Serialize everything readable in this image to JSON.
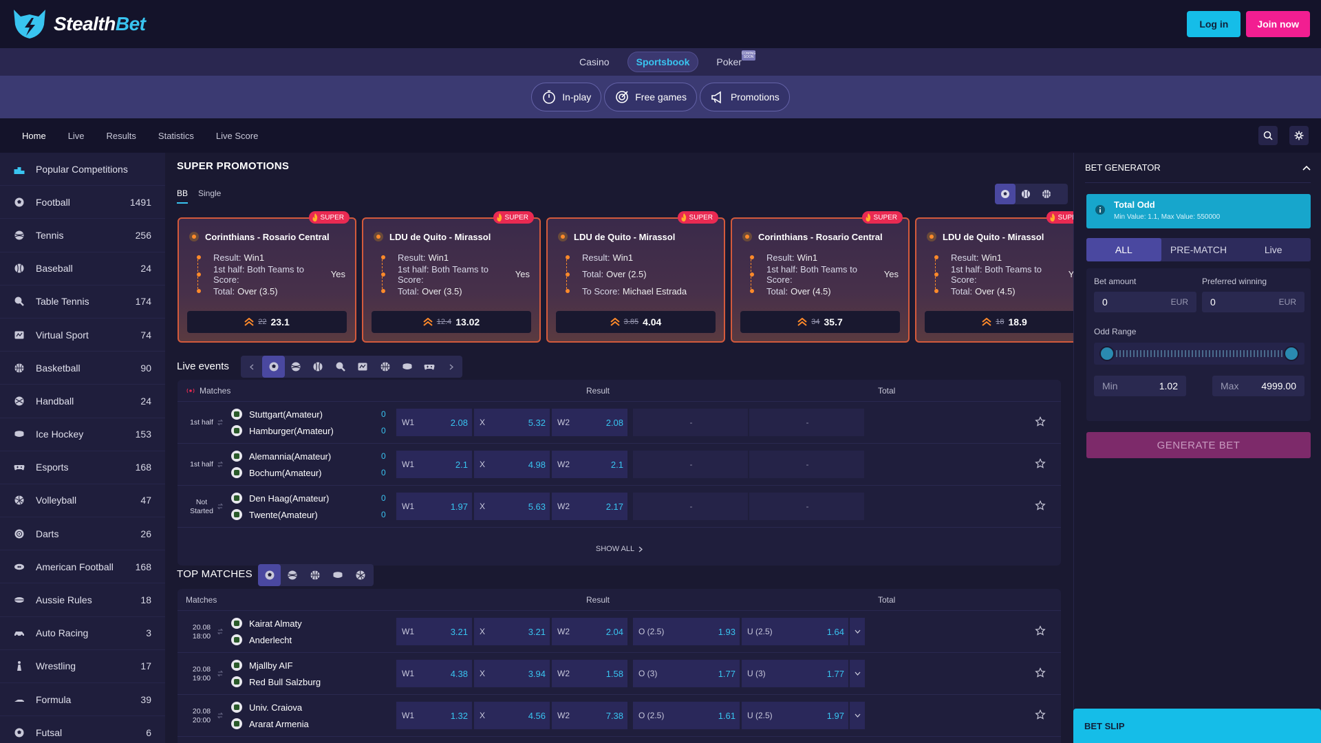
{
  "brand": {
    "name_main": "Stealth",
    "name_accent": "Bet"
  },
  "auth": {
    "login": "Log in",
    "join": "Join now"
  },
  "products": [
    {
      "label": "Casino",
      "active": false
    },
    {
      "label": "Sportsbook",
      "active": true
    },
    {
      "label": "Poker",
      "active": false,
      "badge": "COMING SOON"
    }
  ],
  "subnav": [
    {
      "label": "In-play",
      "icon": "stopwatch-icon"
    },
    {
      "label": "Free games",
      "icon": "target-icon"
    },
    {
      "label": "Promotions",
      "icon": "megaphone-icon"
    }
  ],
  "mainnav": [
    "Home",
    "Live",
    "Results",
    "Statistics",
    "Live Score"
  ],
  "sidebar": [
    {
      "label": "Popular Competitions",
      "count": "",
      "icon": "podium-icon"
    },
    {
      "label": "Football",
      "count": "1491",
      "icon": "football-icon"
    },
    {
      "label": "Tennis",
      "count": "256",
      "icon": "tennis-icon"
    },
    {
      "label": "Baseball",
      "count": "24",
      "icon": "baseball-icon"
    },
    {
      "label": "Table Tennis",
      "count": "174",
      "icon": "table-tennis-icon"
    },
    {
      "label": "Virtual Sport",
      "count": "74",
      "icon": "virtual-sport-icon"
    },
    {
      "label": "Basketball",
      "count": "90",
      "icon": "basketball-icon"
    },
    {
      "label": "Handball",
      "count": "24",
      "icon": "handball-icon"
    },
    {
      "label": "Ice Hockey",
      "count": "153",
      "icon": "ice-hockey-icon"
    },
    {
      "label": "Esports",
      "count": "168",
      "icon": "gamepad-icon"
    },
    {
      "label": "Volleyball",
      "count": "47",
      "icon": "volleyball-icon"
    },
    {
      "label": "Darts",
      "count": "26",
      "icon": "darts-icon"
    },
    {
      "label": "American Football",
      "count": "168",
      "icon": "american-football-icon"
    },
    {
      "label": "Aussie Rules",
      "count": "18",
      "icon": "aussie-rules-icon"
    },
    {
      "label": "Auto Racing",
      "count": "3",
      "icon": "car-icon"
    },
    {
      "label": "Wrestling",
      "count": "17",
      "icon": "wrestling-icon"
    },
    {
      "label": "Formula",
      "count": "39",
      "icon": "formula-icon"
    },
    {
      "label": "Futsal",
      "count": "6",
      "icon": "futsal-icon"
    }
  ],
  "super": {
    "title": "SUPER PROMOTIONS",
    "tabs": [
      "BB",
      "Single"
    ],
    "badge": "SUPER",
    "cards": [
      {
        "match": "Corinthians - Rosario Central",
        "items": [
          [
            "Result:",
            "Win1"
          ],
          [
            "1st half: Both Teams to Score:",
            "Yes"
          ],
          [
            "Total:",
            "Over (3.5)"
          ]
        ],
        "old": "22",
        "odd": "23.1"
      },
      {
        "match": "LDU de Quito - Mirassol",
        "items": [
          [
            "Result:",
            "Win1"
          ],
          [
            "1st half: Both Teams to Score:",
            "Yes"
          ],
          [
            "Total:",
            "Over (3.5)"
          ]
        ],
        "old": "12.4",
        "odd": "13.02"
      },
      {
        "match": "LDU de Quito - Mirassol",
        "items": [
          [
            "Result:",
            "Win1"
          ],
          [
            "Total:",
            "Over (2.5)"
          ],
          [
            "To Score:",
            "Michael Estrada"
          ]
        ],
        "old": "3.85",
        "odd": "4.04"
      },
      {
        "match": "Corinthians - Rosario Central",
        "items": [
          [
            "Result:",
            "Win1"
          ],
          [
            "1st half: Both Teams to Score:",
            "Yes"
          ],
          [
            "Total:",
            "Over (4.5)"
          ]
        ],
        "old": "34",
        "odd": "35.7"
      },
      {
        "match": "LDU de Quito - Mirassol",
        "items": [
          [
            "Result:",
            "Win1"
          ],
          [
            "1st half: Both Teams to Score:",
            "Yes"
          ],
          [
            "Total:",
            "Over (4.5)"
          ]
        ],
        "old": "18",
        "odd": "18.9"
      }
    ]
  },
  "live": {
    "title": "Live events",
    "head": {
      "matches": "Matches",
      "result": "Result",
      "total": "Total"
    },
    "show_all": "SHOW ALL",
    "rows": [
      {
        "period": "1st half",
        "home": "Stuttgart(Amateur)",
        "away": "Hamburger(Amateur)",
        "s1": "0",
        "s2": "0",
        "w1": "2.08",
        "x": "5.32",
        "w2": "2.08",
        "t1": "-",
        "t2": "-"
      },
      {
        "period": "1st half",
        "home": "Alemannia(Amateur)",
        "away": "Bochum(Amateur)",
        "s1": "0",
        "s2": "0",
        "w1": "2.1",
        "x": "4.98",
        "w2": "2.1",
        "t1": "-",
        "t2": "-"
      },
      {
        "period": "Not Started",
        "home": "Den Haag(Amateur)",
        "away": "Twente(Amateur)",
        "s1": "0",
        "s2": "0",
        "w1": "1.97",
        "x": "5.63",
        "w2": "2.17",
        "t1": "-",
        "t2": "-"
      }
    ]
  },
  "top": {
    "title": "TOP MATCHES",
    "head": {
      "matches": "Matches",
      "result": "Result",
      "total": "Total"
    },
    "rows": [
      {
        "date": "20.08",
        "time": "18:00",
        "home": "Kairat Almaty",
        "away": "Anderlecht",
        "w1": "3.21",
        "x": "3.21",
        "w2": "2.04",
        "ok": "O (2.5)",
        "ov": "1.93",
        "uk": "U (2.5)",
        "uv": "1.64"
      },
      {
        "date": "20.08",
        "time": "19:00",
        "home": "Mjallby AIF",
        "away": "Red Bull Salzburg",
        "w1": "4.38",
        "x": "3.94",
        "w2": "1.58",
        "ok": "O (3)",
        "ov": "1.77",
        "uk": "U (3)",
        "uv": "1.77"
      },
      {
        "date": "20.08",
        "time": "20:00",
        "home": "Univ. Craiova",
        "away": "Ararat Armenia",
        "w1": "1.32",
        "x": "4.56",
        "w2": "7.38",
        "ok": "O (2.5)",
        "ov": "1.61",
        "uk": "U (2.5)",
        "uv": "1.97"
      }
    ]
  },
  "labels": {
    "w1": "W1",
    "x": "X",
    "w2": "W2"
  },
  "generator": {
    "title": "BET GENERATOR",
    "total_odd": "Total Odd",
    "total_odd_sub": "Min Value: 1.1, Max Value: 550000",
    "segments": [
      "ALL",
      "PRE-MATCH",
      "Live"
    ],
    "bet_amount_label": "Bet amount",
    "bet_amount": "0",
    "preferred_label": "Preferred winning",
    "preferred": "0",
    "currency": "EUR",
    "odd_range_label": "Odd Range",
    "min_label": "Min",
    "min_value": "1.02",
    "max_label": "Max",
    "max_value": "4999.00",
    "button": "GENERATE BET"
  },
  "betslip": "BET SLIP",
  "colors": {
    "accent": "#39c4f0",
    "brand_pink": "#f21e91",
    "promo_border": "#d45a3c"
  }
}
